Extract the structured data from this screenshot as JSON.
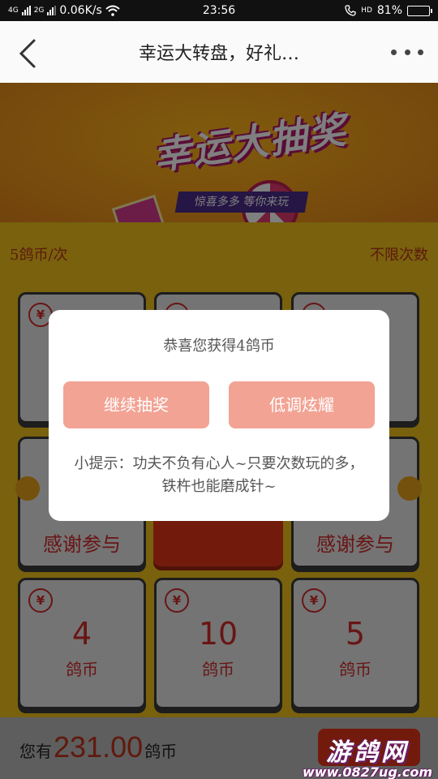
{
  "status_bar": {
    "network_left": "4G",
    "network_right": "2G",
    "speed": "0.06K/s",
    "time": "23:56",
    "hd_label": "HD",
    "battery": "81%"
  },
  "header": {
    "title": "幸运大转盘，好礼…"
  },
  "banner": {
    "logo_title": "幸运大抽奖",
    "logo_subtitle": "惊喜多多 等你来玩"
  },
  "board": {
    "cost_label": "5鸽币/次",
    "limit_label": "不限次数",
    "thanks_label": "感谢参与",
    "yen_symbol": "¥",
    "prizes": [
      {
        "value": "4",
        "unit": "鸽币"
      },
      {
        "value": "10",
        "unit": "鸽币"
      },
      {
        "value": "5",
        "unit": "鸽币"
      }
    ]
  },
  "footer": {
    "balance_prefix": "您有",
    "balance_amount": "231.00",
    "balance_unit": "鸽币"
  },
  "modal": {
    "message": "恭喜您获得4鸽币",
    "continue_label": "继续抽奖",
    "low_key_label": "低调炫耀",
    "tip": "小提示：功夫不负有心人~只要次数玩的多，铁杵也能磨成针~"
  },
  "watermark": {
    "brand": "游鸽网",
    "url": "www.0827ug.com"
  },
  "colors": {
    "accent_red": "#e5361b",
    "button_pink": "#f2a394",
    "board_yellow": "#f3c21b"
  }
}
